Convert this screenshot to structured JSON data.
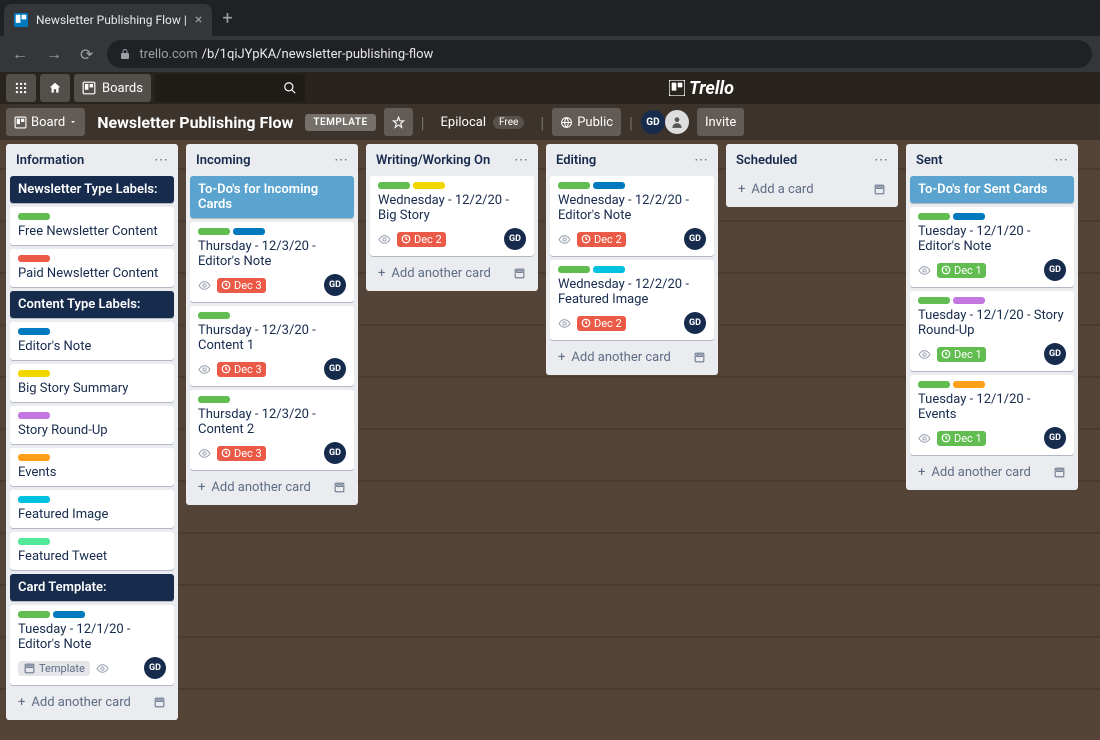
{
  "browser": {
    "tab_title": "Newsletter Publishing Flow |",
    "url_prefix": "trello.com",
    "url_path": "/b/1qiJYpKA/newsletter-publishing-flow"
  },
  "header": {
    "boards": "Boards",
    "logo": "Trello"
  },
  "board": {
    "view": "Board",
    "title": "Newsletter Publishing Flow",
    "template": "TEMPLATE",
    "workspace": "Epilocal",
    "free": "Free",
    "visibility": "Public",
    "invite": "Invite",
    "member": "GD"
  },
  "lists": [
    {
      "title": "Information",
      "cards": [
        {
          "type": "section",
          "title": "Newsletter Type Labels:"
        },
        {
          "labels": [
            "green"
          ],
          "title": "Free Newsletter Content"
        },
        {
          "labels": [
            "red"
          ],
          "title": "Paid Newsletter Content"
        },
        {
          "type": "section",
          "title": "Content Type Labels:"
        },
        {
          "labels": [
            "blue"
          ],
          "title": "Editor's Note"
        },
        {
          "labels": [
            "yellow"
          ],
          "title": "Big Story Summary"
        },
        {
          "labels": [
            "purple"
          ],
          "title": "Story Round-Up"
        },
        {
          "labels": [
            "orange"
          ],
          "title": "Events"
        },
        {
          "labels": [
            "sky"
          ],
          "title": "Featured Image"
        },
        {
          "labels": [
            "lime"
          ],
          "title": "Featured Tweet"
        },
        {
          "type": "section",
          "title": "Card Template:"
        },
        {
          "labels": [
            "green",
            "blue"
          ],
          "title": "Tuesday - 12/1/20 - Editor's Note",
          "template": true,
          "watch": true,
          "member": "GD"
        }
      ],
      "add": "Add another card"
    },
    {
      "title": "Incoming",
      "cards": [
        {
          "type": "todo",
          "title": "To-Do's for Incoming Cards"
        },
        {
          "labels": [
            "green",
            "blue"
          ],
          "title": "Thursday - 12/3/20 - Editor's Note",
          "watch": true,
          "due": "Dec 3",
          "member": "GD"
        },
        {
          "labels": [
            "green"
          ],
          "title": "Thursday - 12/3/20 - Content 1",
          "watch": true,
          "due": "Dec 3",
          "member": "GD"
        },
        {
          "labels": [
            "green"
          ],
          "title": "Thursday - 12/3/20 - Content 2",
          "watch": true,
          "due": "Dec 3",
          "member": "GD"
        }
      ],
      "add": "Add another card"
    },
    {
      "title": "Writing/Working On",
      "cards": [
        {
          "labels": [
            "green",
            "yellow"
          ],
          "title": "Wednesday - 12/2/20 - Big Story",
          "watch": true,
          "due": "Dec 2",
          "member": "GD"
        }
      ],
      "add": "Add another card"
    },
    {
      "title": "Editing",
      "cards": [
        {
          "labels": [
            "green",
            "blue"
          ],
          "title": "Wednesday - 12/2/20 - Editor's Note",
          "watch": true,
          "due": "Dec 2",
          "member": "GD"
        },
        {
          "labels": [
            "green",
            "sky"
          ],
          "title": "Wednesday - 12/2/20 - Featured Image",
          "watch": true,
          "due": "Dec 2",
          "member": "GD"
        }
      ],
      "add": "Add another card"
    },
    {
      "title": "Scheduled",
      "cards": [],
      "add": "Add a card"
    },
    {
      "title": "Sent",
      "cards": [
        {
          "type": "todo",
          "title": "To-Do's for Sent Cards"
        },
        {
          "labels": [
            "green",
            "blue"
          ],
          "title": "Tuesday - 12/1/20 - Editor's Note",
          "watch": true,
          "due": "Dec 1",
          "done": true,
          "member": "GD"
        },
        {
          "labels": [
            "green",
            "purple"
          ],
          "title": "Tuesday - 12/1/20 - Story Round-Up",
          "watch": true,
          "due": "Dec 1",
          "done": true,
          "member": "GD"
        },
        {
          "labels": [
            "green",
            "orange"
          ],
          "title": "Tuesday - 12/1/20 - Events",
          "watch": true,
          "due": "Dec 1",
          "done": true,
          "member": "GD"
        }
      ],
      "add": "Add another card"
    }
  ],
  "template_text": "Template"
}
